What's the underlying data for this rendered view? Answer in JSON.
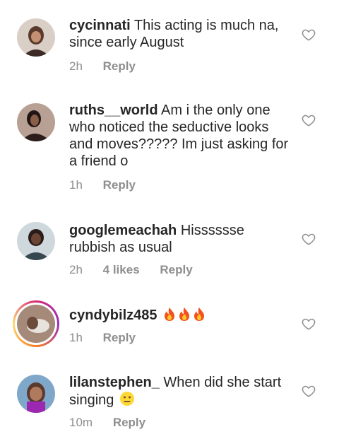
{
  "comments": [
    {
      "username": "cycinnati",
      "text": "This acting is much na, since early August",
      "time": "2h",
      "likes": "",
      "reply_label": "Reply"
    },
    {
      "username": "ruths__world",
      "text": "Am i the only one who noticed the seductive looks and moves????? Im just asking for a friend o",
      "time": "1h",
      "likes": "",
      "reply_label": "Reply"
    },
    {
      "username": "googlemeachah",
      "text": "Hisssssse rubbish as usual",
      "time": "2h",
      "likes": "4 likes",
      "reply_label": "Reply"
    },
    {
      "username": "cyndybilz485",
      "text": "",
      "emoji": "fire-emoji x3",
      "time": "1h",
      "likes": "",
      "reply_label": "Reply"
    },
    {
      "username": "lilanstephen_",
      "text": "When did she start singing",
      "emoji": "neutral-face-emoji",
      "time": "10m",
      "likes": "",
      "reply_label": "Reply"
    }
  ],
  "icons": {
    "like": "heart-outline-icon"
  },
  "colors": {
    "text": "#262626",
    "meta": "#8e8e8e",
    "icon": "#8e8e8e"
  }
}
